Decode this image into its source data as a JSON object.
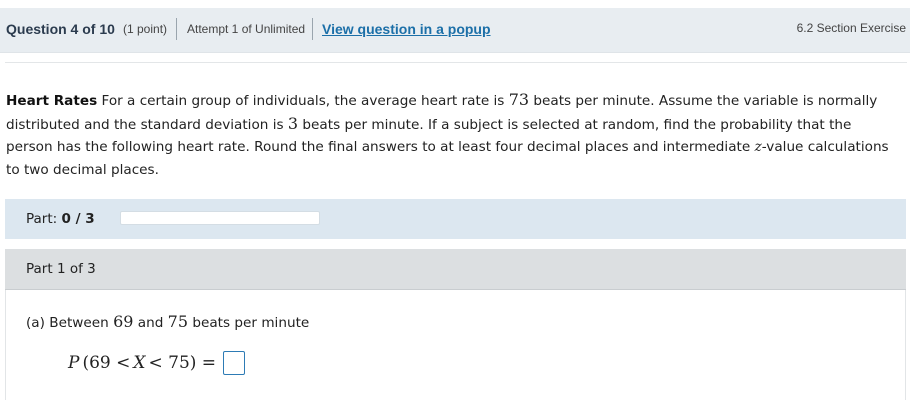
{
  "header": {
    "question": "Question 4 of 10",
    "points": "(1 point)",
    "attempt": "Attempt 1 of Unlimited",
    "popup_link": "View question in a popup",
    "section": "6.2 Section Exercise"
  },
  "problem": {
    "title": "Heart Rates",
    "t1": "For a certain group of individuals, the average heart rate is",
    "mean": "73",
    "t2": "beats per minute. Assume the variable is normally",
    "t3": "distributed and the standard deviation is",
    "sd": "3",
    "t4": "beats per minute. If a subject is selected at random, find the probability that the",
    "t5": "person has the following heart rate. Round the final answers to at least four decimal places and intermediate",
    "z": "z",
    "t6": "-value calculations",
    "t7": "to two decimal places."
  },
  "progress": {
    "label": "Part:",
    "value": "0 / 3",
    "fraction": 0
  },
  "part": {
    "label": "Part 1 of 3"
  },
  "question_a": {
    "prefix": "(a) Between",
    "low": "69",
    "and": "and",
    "high": "75",
    "suffix": "beats per minute",
    "eq_p": "P",
    "eq_open": "(69 <",
    "eq_x": "X",
    "eq_close": "< 75) ="
  }
}
